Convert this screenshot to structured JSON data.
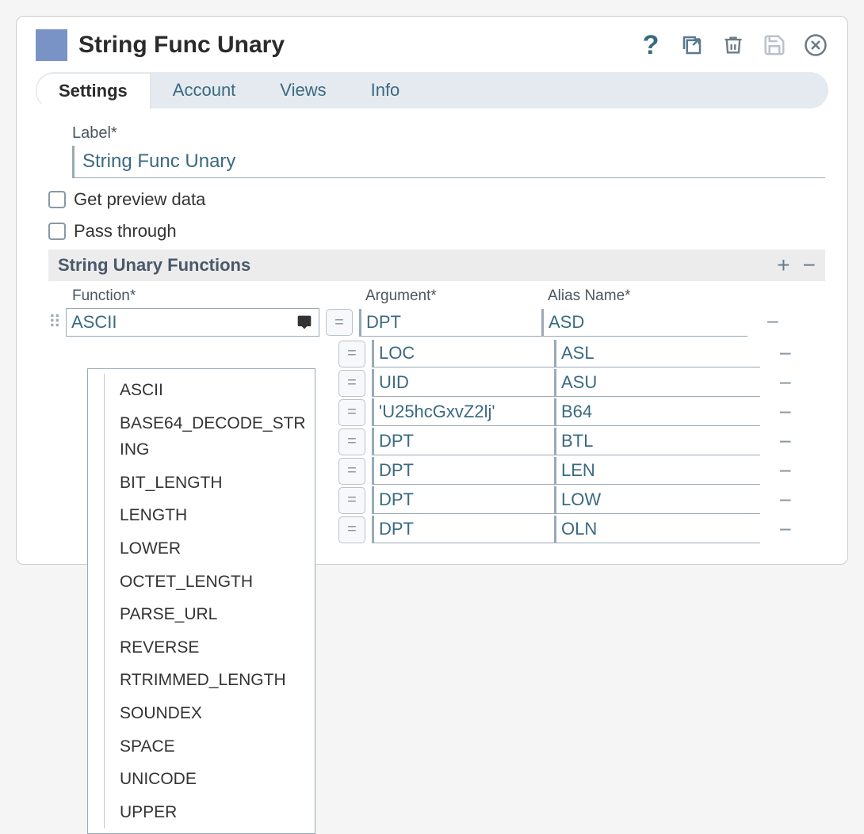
{
  "header": {
    "title": "String Func Unary"
  },
  "tabs": [
    {
      "label": "Settings",
      "active": true
    },
    {
      "label": "Account",
      "active": false
    },
    {
      "label": "Views",
      "active": false
    },
    {
      "label": "Info",
      "active": false
    }
  ],
  "form": {
    "label_field_label": "Label*",
    "label_value": "String Func Unary",
    "checkbox_preview": "Get preview data",
    "checkbox_passthrough": "Pass through"
  },
  "section": {
    "title": "String Unary Functions"
  },
  "columns": {
    "function": "Function*",
    "argument": "Argument*",
    "alias": "Alias Name*"
  },
  "rows": [
    {
      "fn": "ASCII",
      "arg": "DPT",
      "alias": "ASD",
      "first": true
    },
    {
      "fn": "",
      "arg": "LOC",
      "alias": "ASL"
    },
    {
      "fn": "",
      "arg": "UID",
      "alias": "ASU"
    },
    {
      "fn": "",
      "arg": "'U25hcGxvZ2lj'",
      "alias": "B64"
    },
    {
      "fn": "",
      "arg": "DPT",
      "alias": "BTL"
    },
    {
      "fn": "",
      "arg": "DPT",
      "alias": "LEN"
    },
    {
      "fn": "",
      "arg": "DPT",
      "alias": "LOW"
    },
    {
      "fn": "",
      "arg": "DPT",
      "alias": "OLN"
    }
  ],
  "dropdown_options": [
    "ASCII",
    "BASE64_DECODE_STRING",
    "BIT_LENGTH",
    "LENGTH",
    "LOWER",
    "OCTET_LENGTH",
    "PARSE_URL",
    "REVERSE",
    "RTRIMMED_LENGTH",
    "SOUNDEX",
    "SPACE",
    "UNICODE",
    "UPPER"
  ]
}
